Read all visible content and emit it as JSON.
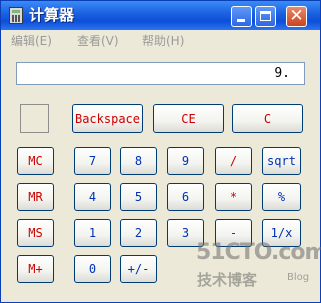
{
  "window": {
    "title": "计算器",
    "title_bar_color": "#0d4fd8",
    "controls": {
      "minimize_icon": "minimize-icon",
      "maximize_icon": "maximize-icon",
      "close_icon": "close-icon",
      "close_glyph": "✕"
    }
  },
  "menu": [
    {
      "label": "编辑(E)"
    },
    {
      "label": "查看(V)"
    },
    {
      "label": "帮助(H)"
    }
  ],
  "display": {
    "value": "9."
  },
  "buttons": {
    "backspace": "Backspace",
    "ce": "CE",
    "c": "C",
    "mc": "MC",
    "mr": "MR",
    "ms": "MS",
    "mplus": "M+",
    "n7": "7",
    "n8": "8",
    "n9": "9",
    "n4": "4",
    "n5": "5",
    "n6": "6",
    "n1": "1",
    "n2": "2",
    "n3": "3",
    "n0": "0",
    "plusminus": "+/-",
    "divide": "/",
    "multiply": "*",
    "subtract": "-",
    "sqrt": "sqrt",
    "percent": "%",
    "reciprocal": "1/x"
  },
  "colors": {
    "operator_text": "#cc0000",
    "digit_text": "#0032b4",
    "face": "#ece9d8"
  },
  "watermark": {
    "main": "51CTO.com",
    "sub": "技术博客",
    "blog": "Blog"
  }
}
